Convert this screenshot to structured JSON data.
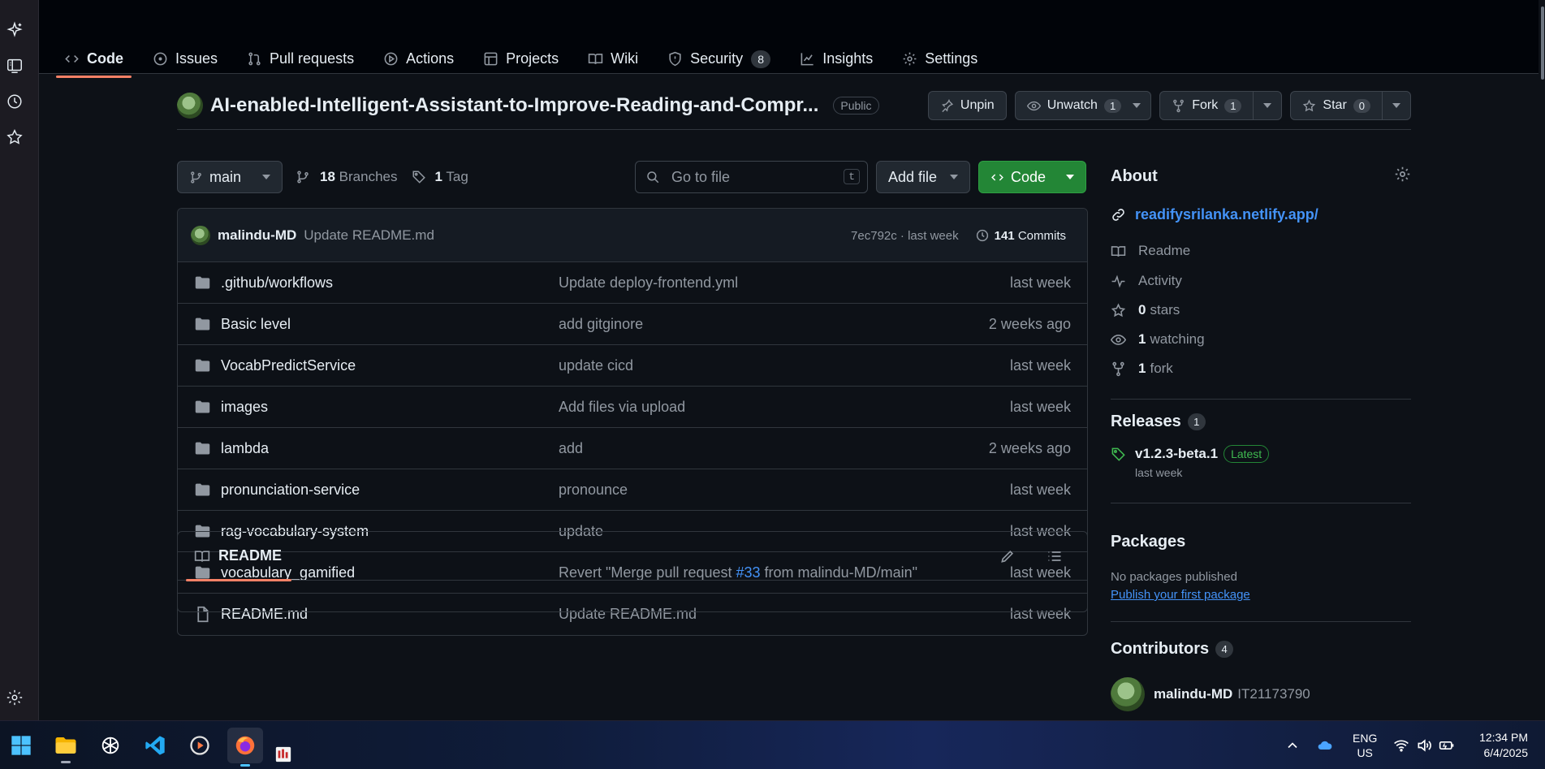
{
  "repo": {
    "name": "AI-enabled-Intelligent-Assistant-to-Improve-Reading-and-Compr...",
    "visibility": "Public",
    "unpin_label": "Unpin",
    "unwatch_label": "Unwatch",
    "watch_count": "1",
    "fork_label": "Fork",
    "fork_count": "1",
    "star_label": "Star",
    "star_count": "0"
  },
  "nav": {
    "tabs": [
      {
        "label": "Code",
        "icon": "code-icon"
      },
      {
        "label": "Issues",
        "icon": "issue-icon"
      },
      {
        "label": "Pull requests",
        "icon": "pull-request-icon"
      },
      {
        "label": "Actions",
        "icon": "play-icon"
      },
      {
        "label": "Projects",
        "icon": "table-icon"
      },
      {
        "label": "Wiki",
        "icon": "book-icon"
      },
      {
        "label": "Security",
        "icon": "shield-icon",
        "count": "8"
      },
      {
        "label": "Insights",
        "icon": "graph-icon"
      },
      {
        "label": "Settings",
        "icon": "gear-icon"
      }
    ]
  },
  "toolbar": {
    "branch": "main",
    "branches_count": "18",
    "branches_label": "Branches",
    "tags_count": "1",
    "tags_label": "Tag",
    "goto_placeholder": "Go to file",
    "goto_shortcut": "t",
    "add_file_label": "Add file",
    "code_label": "Code"
  },
  "commit": {
    "author": "malindu-MD",
    "message": "Update README.md",
    "hash_time": "7ec792c · last week",
    "commits_count": "141",
    "commits_label": "Commits"
  },
  "files": [
    {
      "type": "folder",
      "name": ".github/workflows",
      "message": "Update deploy-frontend.yml",
      "date": "last week"
    },
    {
      "type": "folder",
      "name": "Basic level",
      "message": "add gitginore",
      "date": "2 weeks ago"
    },
    {
      "type": "folder",
      "name": "VocabPredictService",
      "message": "update cicd",
      "date": "last week"
    },
    {
      "type": "folder",
      "name": "images",
      "message": "Add files via upload",
      "date": "last week"
    },
    {
      "type": "folder",
      "name": "lambda",
      "message": "add",
      "date": "2 weeks ago"
    },
    {
      "type": "folder",
      "name": "pronunciation-service",
      "message": "pronounce",
      "date": "last week"
    },
    {
      "type": "folder",
      "name": "rag-vocabulary-system",
      "message": "update",
      "date": "last week"
    },
    {
      "type": "folder",
      "name": "vocabulary_gamified",
      "message_pre": "Revert \"Merge pull request ",
      "message_link": "#33",
      "message_post": " from malindu-MD/main\"",
      "date": "last week"
    },
    {
      "type": "file",
      "name": "README.md",
      "message": "Update README.md",
      "date": "last week"
    }
  ],
  "readme": {
    "tab_label": "README"
  },
  "about": {
    "heading": "About",
    "link": "readifysrilanka.netlify.app/",
    "readme": "Readme",
    "activity": "Activity",
    "stars_count": "0",
    "stars_label": "stars",
    "watching_count": "1",
    "watching_label": "watching",
    "forks_count": "1",
    "forks_label": "fork"
  },
  "releases": {
    "heading": "Releases",
    "count": "1",
    "tag": "v1.2.3-beta.1",
    "badge": "Latest",
    "date": "last week"
  },
  "packages": {
    "heading": "Packages",
    "none_text": "No packages published",
    "publish_link": "Publish your first package"
  },
  "contributors": {
    "heading": "Contributors",
    "count": "4",
    "top_name": "malindu-MD",
    "top_id": "IT21173790"
  },
  "taskbar": {
    "lang_line1": "ENG",
    "lang_line2": "US",
    "time": "12:34 PM",
    "date": "6/4/2025"
  },
  "colors": {
    "accent_underline": "#f78166",
    "link": "#4493f8",
    "code_button": "#238636",
    "latest_badge": "#3fb950"
  }
}
